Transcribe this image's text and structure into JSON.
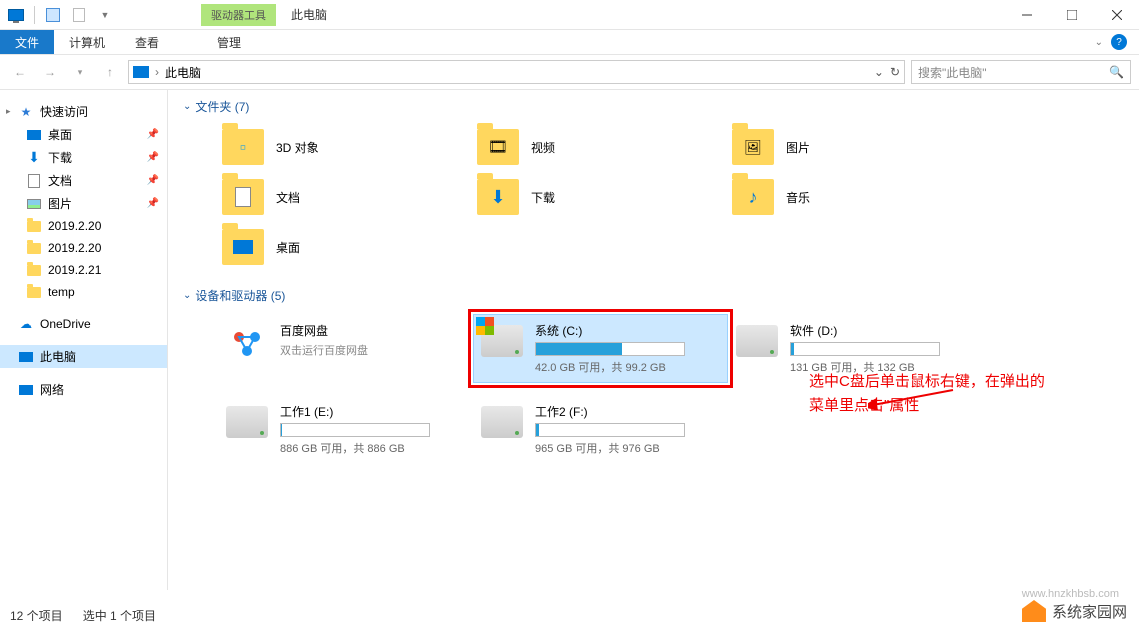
{
  "window": {
    "title": "此电脑",
    "drive_tools": "驱动器工具",
    "manage": "管理"
  },
  "ribbon": {
    "file": "文件",
    "computer": "计算机",
    "view": "查看"
  },
  "address": {
    "location": "此电脑",
    "search_placeholder": "搜索\"此电脑\""
  },
  "sidebar": {
    "quick_access": "快速访问",
    "desktop": "桌面",
    "downloads": "下载",
    "documents": "文档",
    "pictures": "图片",
    "f1": "2019.2.20",
    "f2": "2019.2.20",
    "f3": "2019.2.21",
    "f4": "temp",
    "onedrive": "OneDrive",
    "thispc": "此电脑",
    "network": "网络"
  },
  "sections": {
    "folders": "文件夹 (7)",
    "devices": "设备和驱动器 (5)"
  },
  "folders": {
    "obj3d": "3D 对象",
    "video": "视频",
    "pictures": "图片",
    "documents": "文档",
    "downloads": "下载",
    "music": "音乐",
    "desktop": "桌面"
  },
  "drives": {
    "baidu": {
      "name": "百度网盘",
      "sub": "双击运行百度网盘"
    },
    "c": {
      "name": "系统 (C:)",
      "detail": "42.0 GB 可用，共 99.2 GB",
      "fill": 58
    },
    "d": {
      "name": "软件 (D:)",
      "detail": "131 GB 可用，共 132 GB",
      "fill": 2
    },
    "e": {
      "name": "工作1 (E:)",
      "detail": "886 GB 可用，共 886 GB",
      "fill": 1
    },
    "f": {
      "name": "工作2 (F:)",
      "detail": "965 GB 可用，共 976 GB",
      "fill": 2
    }
  },
  "annotation": {
    "line1": "选中C盘后单击鼠标右键，在弹出的",
    "line2": "菜单里点击\"属性"
  },
  "status": {
    "items": "12 个项目",
    "selected": "选中 1 个项目"
  },
  "watermark": {
    "text": "系统家园网",
    "url": "www.hnzkhbsb.com"
  }
}
